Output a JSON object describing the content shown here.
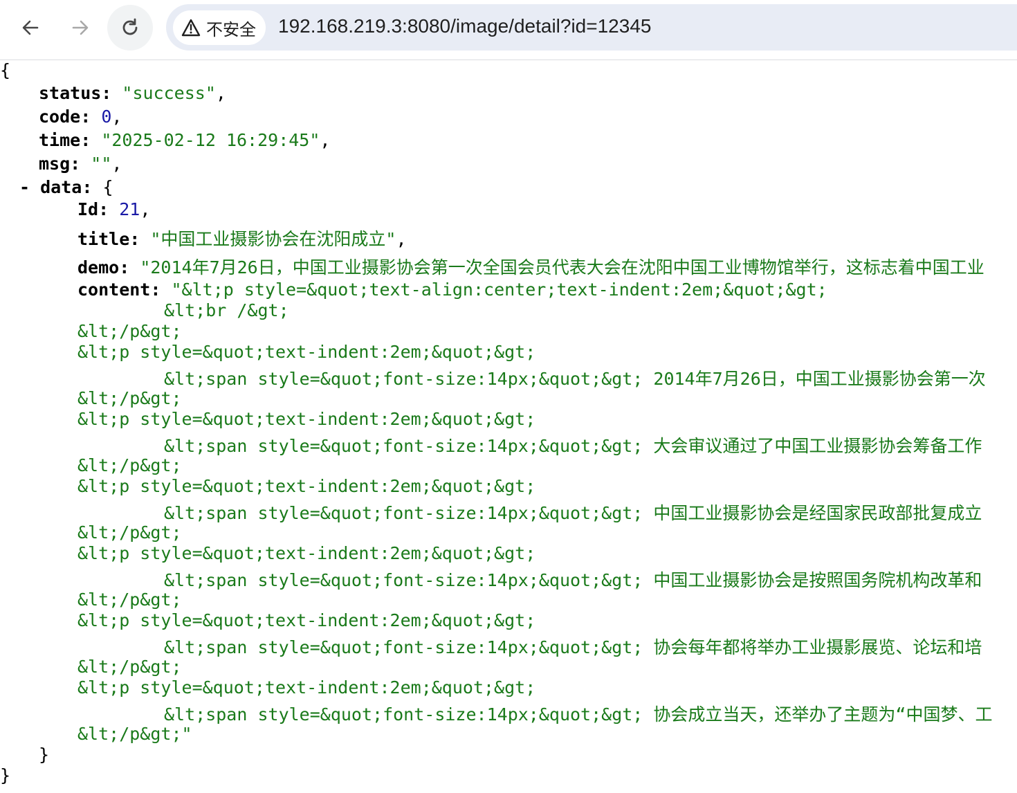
{
  "browser": {
    "security_label": "不安全",
    "url": "192.168.219.3:8080/image/detail?id=12345"
  },
  "json": {
    "open_brace": "{",
    "close_brace": "}",
    "status": {
      "key": "status:",
      "value": "\"success\"",
      "comma": ","
    },
    "code": {
      "key": "code:",
      "value": "0",
      "comma": ","
    },
    "time": {
      "key": "time:",
      "value": "\"2025-02-12 16:29:45\"",
      "comma": ","
    },
    "msg": {
      "key": "msg:",
      "value": "\"\"",
      "comma": ","
    },
    "data": {
      "toggle": "-",
      "key": "data:",
      "open_brace": "{",
      "close_brace": "}",
      "id": {
        "key": "Id:",
        "value": "21",
        "comma": ","
      },
      "title": {
        "key": "title:",
        "value": "\"中国工业摄影协会在沈阳成立\"",
        "comma": ","
      },
      "demo": {
        "key": "demo:",
        "value": "\"2014年7月26日，中国工业摄影协会第一次全国会员代表大会在沈阳中国工业博物馆举行，这标志着中国工业"
      },
      "content": {
        "key": "content:",
        "lines": [
          "\"&lt;p style=&quot;text-align:center;text-indent:2em;&quot;&gt;",
          "&lt;br /&gt;",
          "&lt;/p&gt;",
          "&lt;p style=&quot;text-indent:2em;&quot;&gt;",
          "&lt;span style=&quot;font-size:14px;&quot;&gt; 2014年7月26日，中国工业摄影协会第一次",
          "&lt;/p&gt;",
          "&lt;p style=&quot;text-indent:2em;&quot;&gt;",
          "&lt;span style=&quot;font-size:14px;&quot;&gt; 大会审议通过了中国工业摄影协会筹备工作",
          "&lt;/p&gt;",
          "&lt;p style=&quot;text-indent:2em;&quot;&gt;",
          "&lt;span style=&quot;font-size:14px;&quot;&gt; 中国工业摄影协会是经国家民政部批复成立",
          "&lt;/p&gt;",
          "&lt;p style=&quot;text-indent:2em;&quot;&gt;",
          "&lt;span style=&quot;font-size:14px;&quot;&gt; 中国工业摄影协会是按照国务院机构改革和",
          "&lt;/p&gt;",
          "&lt;p style=&quot;text-indent:2em;&quot;&gt;",
          "&lt;span style=&quot;font-size:14px;&quot;&gt; 协会每年都将举办工业摄影展览、论坛和培",
          "&lt;/p&gt;",
          "&lt;p style=&quot;text-indent:2em;&quot;&gt;",
          "&lt;span style=&quot;font-size:14px;&quot;&gt; 协会成立当天，还举办了主题为“中国梦、工",
          "&lt;/p&gt;\""
        ]
      }
    }
  }
}
